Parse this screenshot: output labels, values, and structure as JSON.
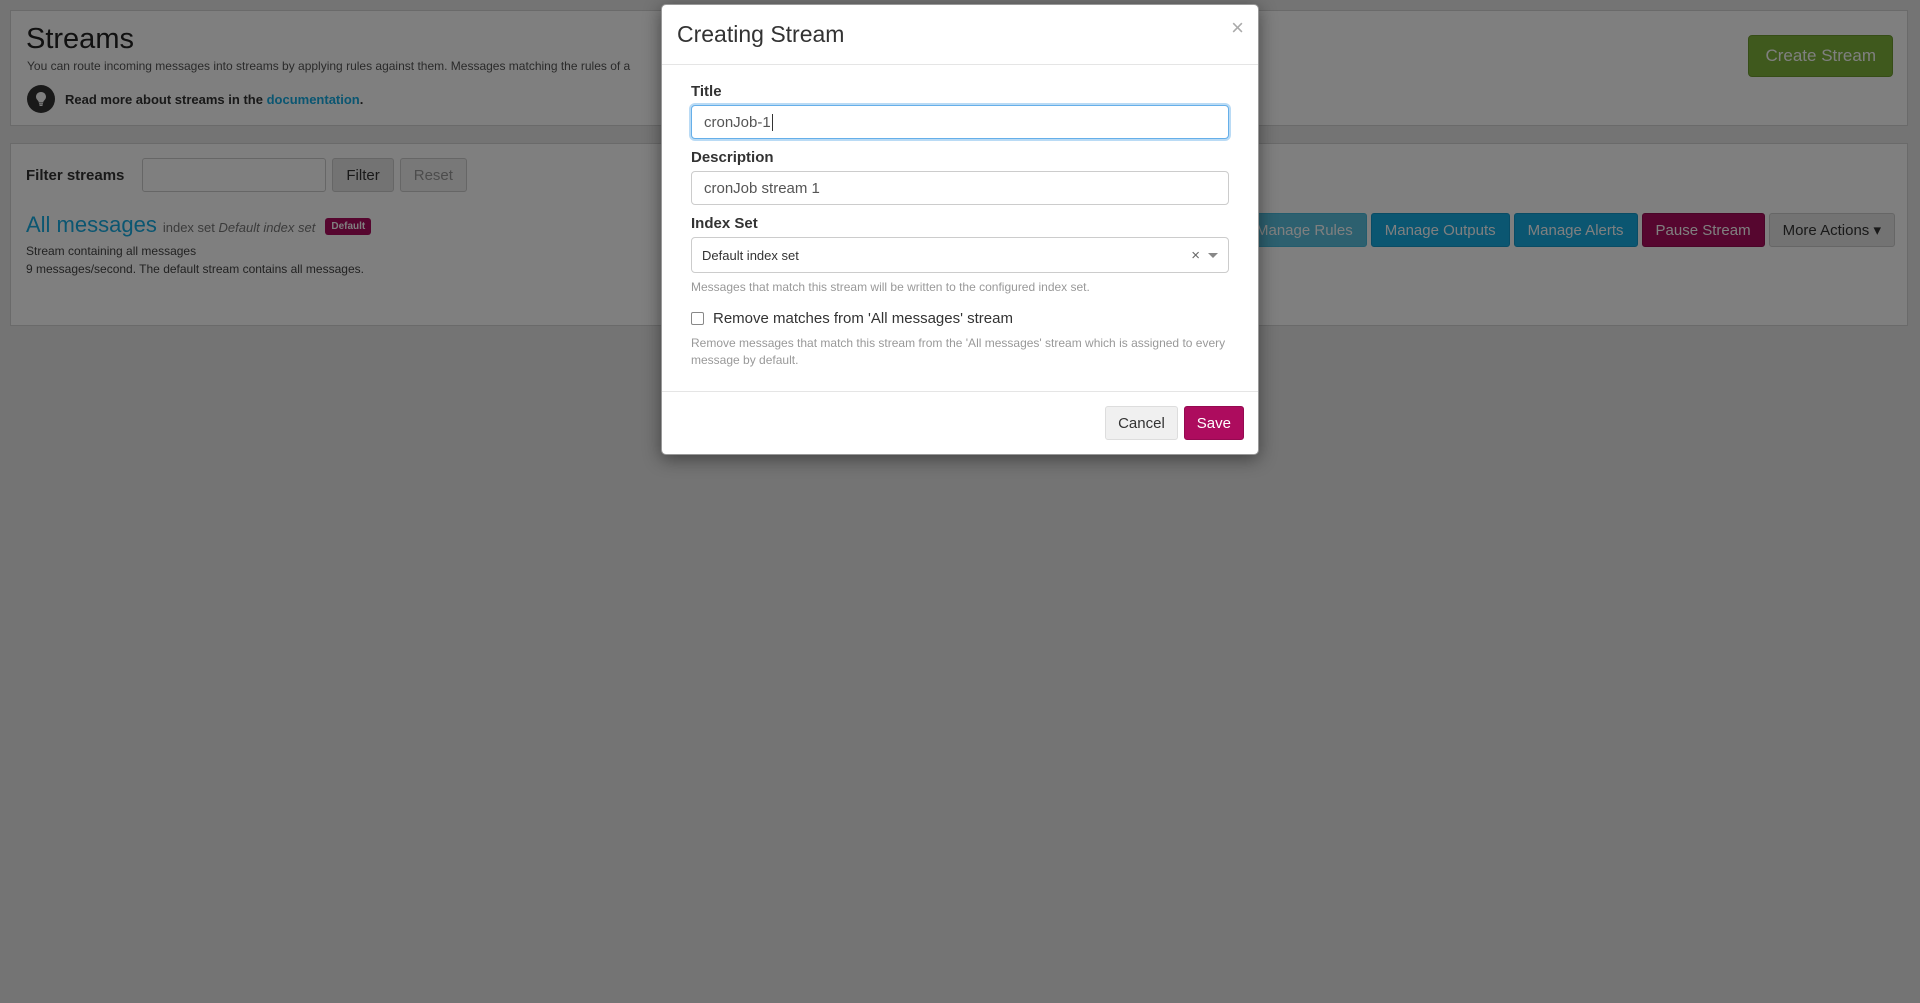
{
  "page": {
    "title": "Streams",
    "description": "You can route incoming messages into streams by applying rules against them. Messages matching the rules of a",
    "tip_prefix": "Read more about streams in the",
    "tip_link": "documentation",
    "tip_suffix": ".",
    "create_button": "Create Stream"
  },
  "filter": {
    "label": "Filter streams",
    "input_value": "",
    "filter_button": "Filter",
    "reset_button": "Reset"
  },
  "stream": {
    "title": "All messages",
    "index_set_prefix": "index set",
    "index_set_name": "Default index set",
    "badge": "Default",
    "description": "Stream containing all messages",
    "throughput": "9 messages/second. The default stream contains all messages.",
    "actions": {
      "manage_rules": "Manage Rules",
      "manage_outputs": "Manage Outputs",
      "manage_alerts": "Manage Alerts",
      "pause_stream": "Pause Stream",
      "more_actions": "More Actions"
    }
  },
  "modal": {
    "title": "Creating Stream",
    "close_symbol": "×",
    "title_label": "Title",
    "title_value": "cronJob-1",
    "description_label": "Description",
    "description_value": "cronJob stream 1",
    "index_set_label": "Index Set",
    "index_set_value": "Default index set",
    "index_set_clear": "×",
    "index_set_help": "Messages that match this stream will be written to the configured index set.",
    "remove_matches_label": "Remove matches from 'All messages' stream",
    "remove_matches_checked": false,
    "remove_matches_help": "Remove messages that match this stream from the 'All messages' stream which is assigned to every message by default.",
    "cancel_button": "Cancel",
    "save_button": "Save"
  },
  "colors": {
    "accent_pink": "#ad0c5e",
    "accent_blue": "#16ace3",
    "accent_green": "#7fb33a"
  }
}
